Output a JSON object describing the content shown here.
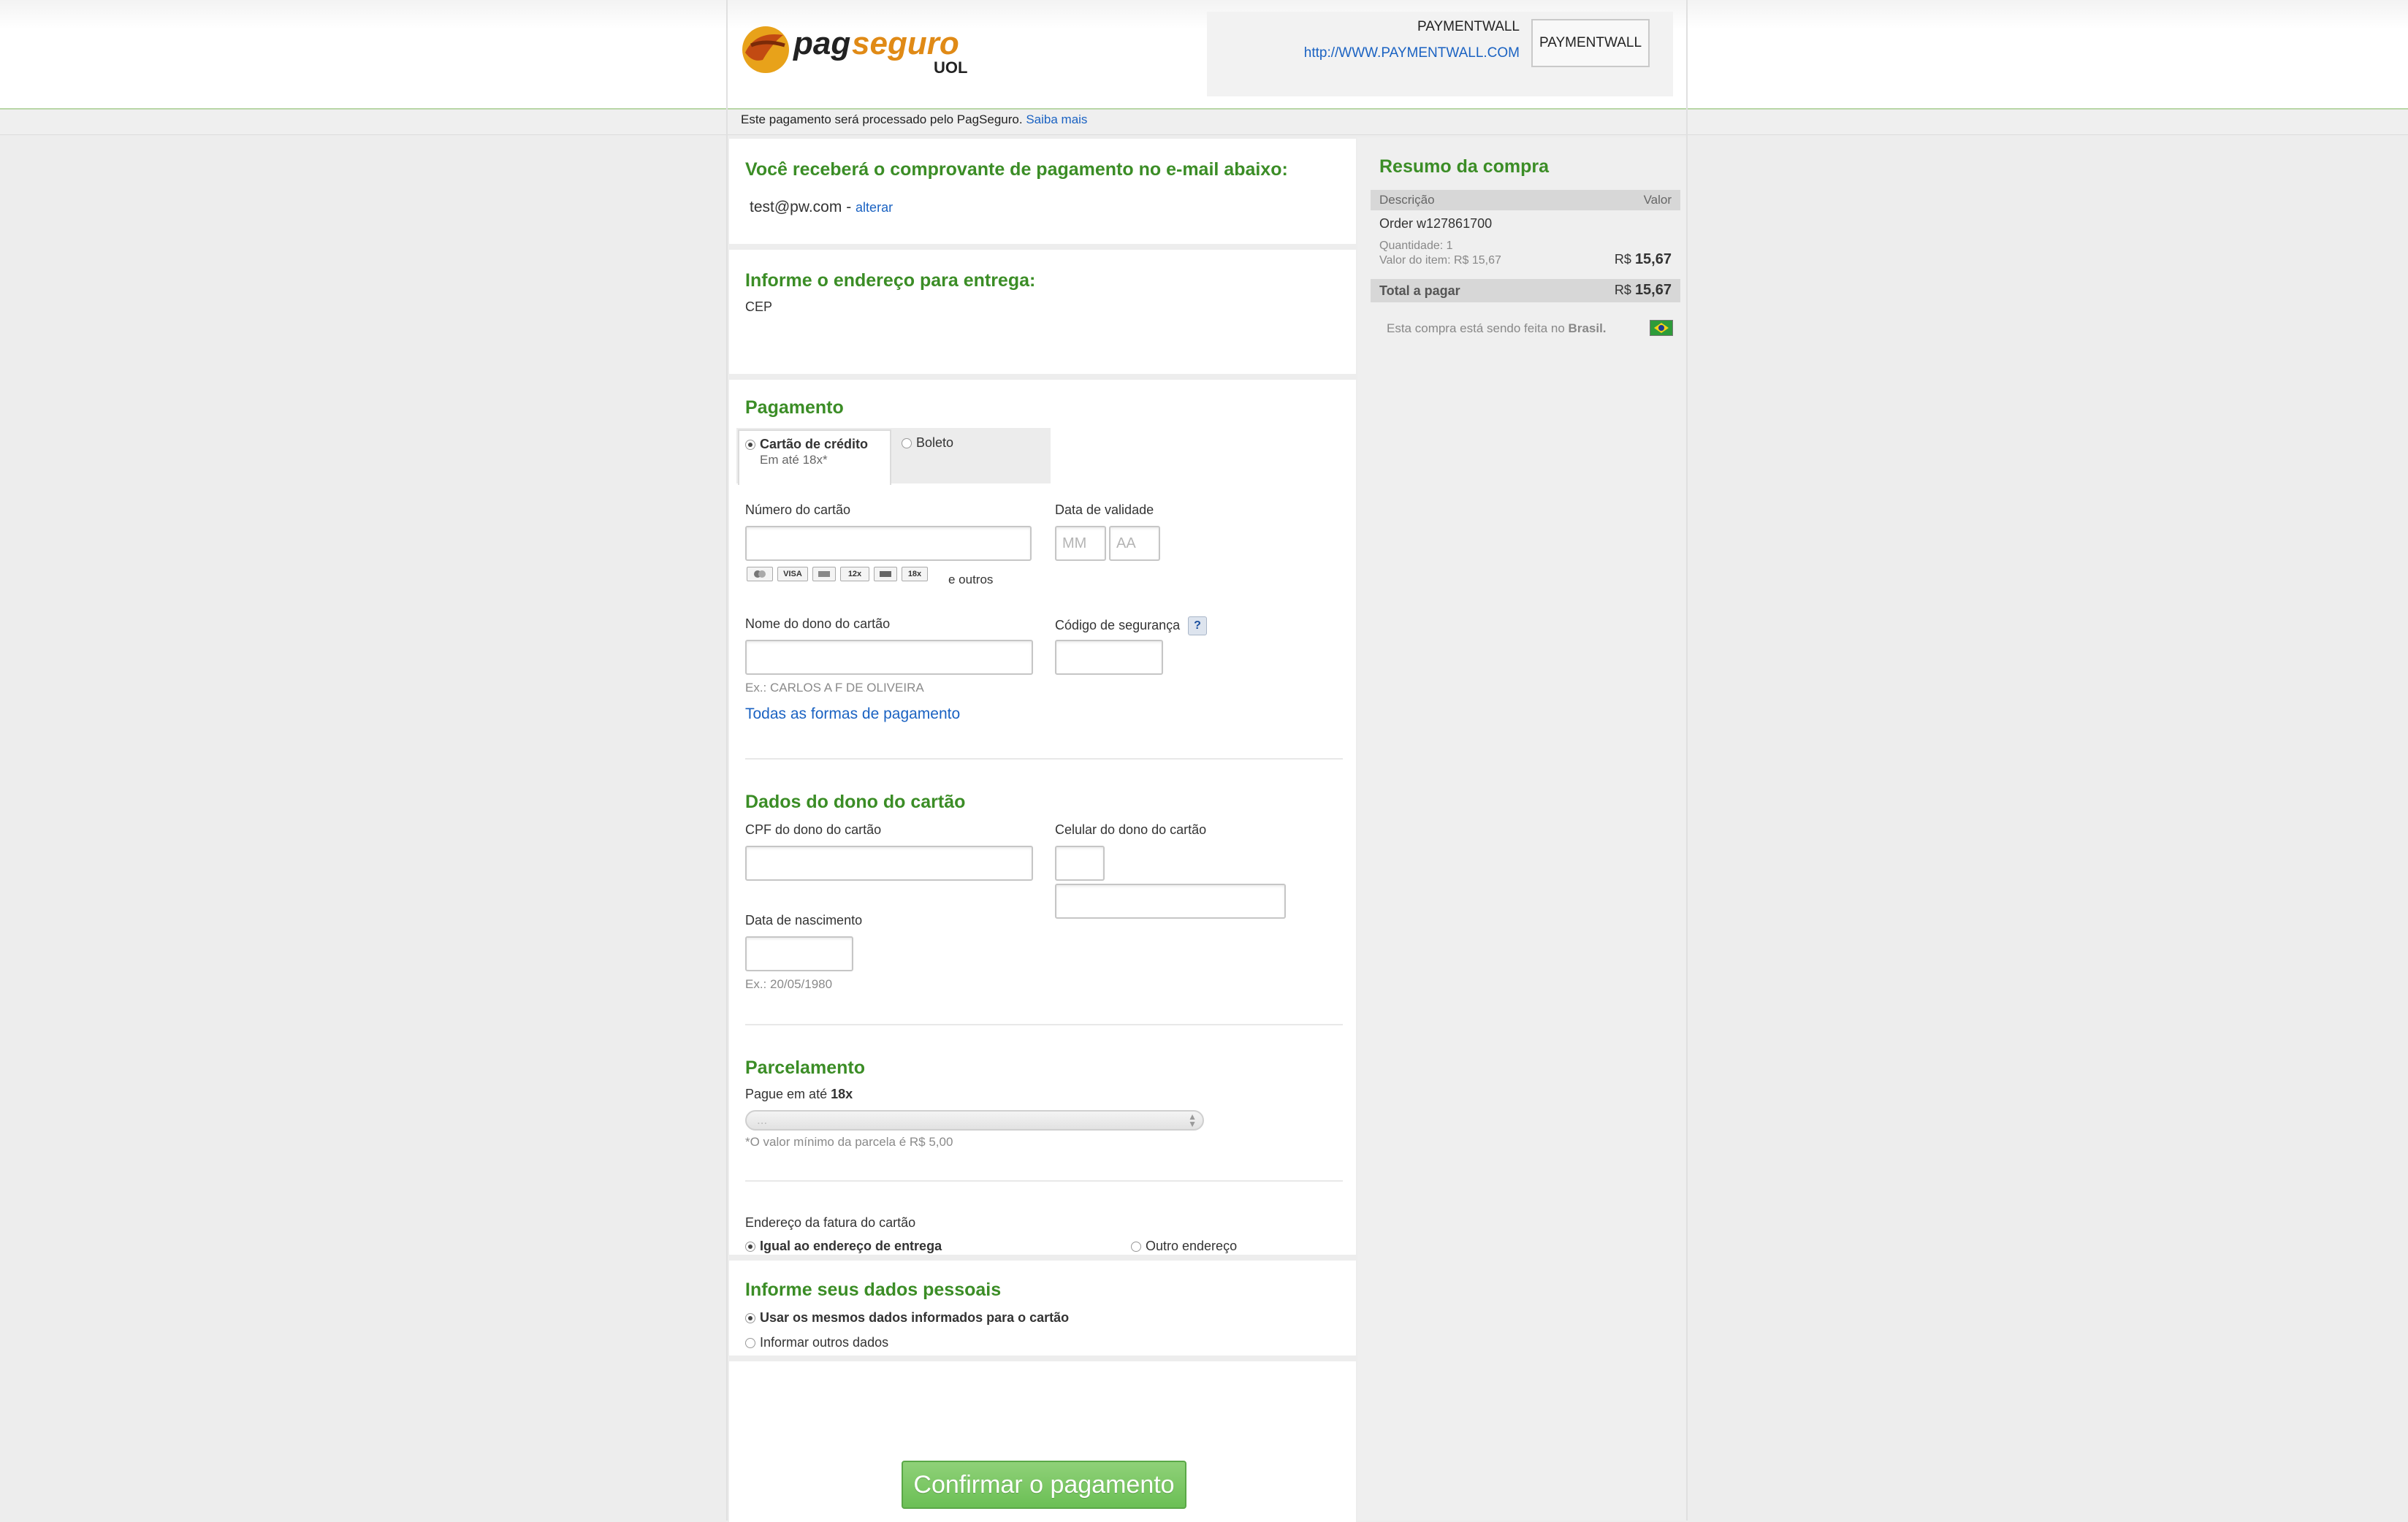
{
  "header": {
    "merchant_name": "PAYMENTWALL",
    "merchant_url": "http://WWW.PAYMENTWALL.COM",
    "merchant_logo_text": "PAYMENTWALL",
    "notice_text": "Este pagamento será processado pelo PagSeguro.",
    "notice_link": "Saiba mais"
  },
  "email_section": {
    "title": "Você receberá o comprovante de pagamento no e-mail abaixo:",
    "email": "test@pw.com",
    "separator": "-",
    "change_link": "alterar"
  },
  "address_section": {
    "title": "Informe o endereço para entrega:",
    "cep_label": "CEP"
  },
  "payment_section": {
    "title": "Pagamento",
    "tabs": [
      {
        "label": "Cartão de crédito",
        "sublabel": "Em até 18x*",
        "selected": true
      },
      {
        "label": "Boleto",
        "selected": false
      }
    ],
    "card_number_label": "Número do cartão",
    "card_brands": [
      "VISA",
      "12x",
      "18x"
    ],
    "card_brands_more": "e outros",
    "expiry_label": "Data de validade",
    "expiry_month_placeholder": "MM",
    "expiry_year_placeholder": "AA",
    "holder_name_label": "Nome do dono do cartão",
    "holder_name_hint": "Ex.: CARLOS A F DE OLIVEIRA",
    "security_code_label": "Código de segurança",
    "security_help": "?",
    "all_methods_link": "Todas as formas de pagamento"
  },
  "holder_section": {
    "title": "Dados do dono do cartão",
    "cpf_label": "CPF do dono do cartão",
    "phone_label": "Celular do dono do cartão",
    "birth_label": "Data de nascimento",
    "birth_hint": "Ex.: 20/05/1980"
  },
  "installments_section": {
    "title": "Parcelamento",
    "pay_up_to_label": "Pague em até",
    "pay_up_to_value": "18x",
    "select_value": "...",
    "note": "*O valor mínimo da parcela é R$ 5,00"
  },
  "billing_section": {
    "label": "Endereço da fatura do cartão",
    "option_same": "Igual ao endereço de entrega",
    "option_other": "Outro endereço"
  },
  "personal_section": {
    "title": "Informe seus dados pessoais",
    "option_same": "Usar os mesmos dados informados para o cartão",
    "option_other": "Informar outros dados"
  },
  "confirm_button": "Confirmar o pagamento",
  "summary": {
    "title": "Resumo da compra",
    "col_description": "Descrição",
    "col_value": "Valor",
    "order": "Order w127861700",
    "quantity": "Quantidade: 1",
    "item_value": "Valor do item: R$ 15,67",
    "currency": "R$",
    "amount": "15,67",
    "total_label": "Total a pagar",
    "total_currency": "R$",
    "total_amount": "15,67",
    "country_text_prefix": "Esta compra está sendo feita no",
    "country_name": "Brasil."
  },
  "colors": {
    "section_title": "#3b8d26",
    "link": "#1a62c2",
    "confirm_button": "#6bbf55"
  }
}
